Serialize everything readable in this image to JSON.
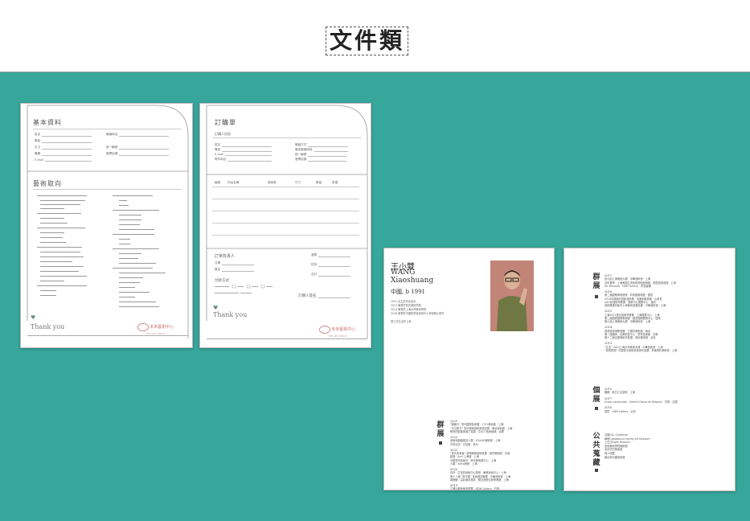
{
  "header": {
    "title": "文件類"
  },
  "doc1": {
    "section1_title": "基本資料",
    "fields_left": [
      "姓名",
      "電話",
      "生日",
      "職業",
      "E-mail"
    ],
    "fields_right": [
      "聯絡地址",
      "統一編號",
      "發票抬頭"
    ],
    "section2_title": "藝術取向",
    "thank_you": "Thank you",
    "logo_name": "未未藝術中心",
    "logo_en": "THE ART SPACE"
  },
  "doc2": {
    "section1_title": "訂購單",
    "subtitle": "訂購人訊息",
    "fields_left": [
      "姓名",
      "電話",
      "E-mail",
      "寄件地址"
    ],
    "fields_right": [
      "聯絡方式",
      "最佳聯絡時段",
      "統一編號",
      "發票抬頭"
    ],
    "table_headers": [
      "編號",
      "作品名稱",
      "藝術家",
      "尺寸",
      "數量",
      "售價"
    ],
    "section2_title": "訂單負責人",
    "fields_sign": [
      "日期",
      "簽名"
    ],
    "payment_title": "付款方式",
    "amount_labels": [
      "運費",
      "折扣",
      "合計"
    ],
    "buyer_sign": "訂購人簽名",
    "thank_you": "Thank you",
    "logo_name": "未未藝術中心",
    "logo_en": "THE ART SPACE"
  },
  "doc3": {
    "name_zh": "王小雙",
    "name_en_1": "WANG",
    "name_en_2": "Xiaoshuang",
    "origin": "中國, b 1991",
    "edu": [
      "1991 出生於河北滄州",
      "2012 畢業於西安美術學院",
      "2014 畢業於上海大學美術學院",
      "2018 畢業於中國哲學藝術當代人事術碩士研究"
    ],
    "now": "現工作生活於上海",
    "group_label": "群展",
    "group_shows": [
      {
        "year": "2023",
        "lines": [
          "“脆脆分” 當代國際藝術展 · 1723美術館 · 上海",
          "“今日夜才” 當代美術藝術家邀請展 · 海派藝術館 · 上海",
          "歌聲的鏡像與潮了寫題 · 意AO7藝術機構 · 合肥"
        ]
      },
      {
        "year": "2022",
        "lines": [
          "藝術和遊戲邀請人展 · YOUNG美術館 · 上海",
          "不同北京 · 日控館 · 杭州"
        ]
      },
      {
        "year": "2021",
        "lines": [
          "“當代未來者” 新興美術藝術家展 · 城市美術館 · 天津",
          "新館 · Art+上海館 · 上海",
          "中國當代藝術中 · 當代美術館中心 · 上海",
          "人類 · Artco美術 · 上海"
        ]
      },
      {
        "year": "2020",
        "lines": [
          "向外 · 生長的藝術中心發覺 · 華美藝術中心 · 上海",
          "第十八屆 “新中國” 藝術邀請聯展 · 中華藝術宮 · 上海",
          "鄰裡聯 · 高此屬寺藝誌 · 塑出藝數位術學美館 · 上海"
        ]
      },
      {
        "year": "2019",
        "lines": [
          "江蘇后網藝術學響展 · HDM Gallery · 巴黎",
          "In There Life On Earth · 閃爍大道美術館 · 上本其",
          "法國吊數在行響年展 · 安閣大學 · 法國",
          "Art Brussels · HDM Gallery · 布魯塞爾"
        ]
      },
      {
        "year": "2018",
        "lines": [
          "江蘇后網藝術學響展 · HDM Gallery · 巴黎",
          "藝術面對 · 當時學術中心 · 杭州",
          "青春在於旬形 · 雲何何 · 本藝術當代美術館 · 上海",
          "國藝術中國學術學術計劃 · 國藝術學術學術 · 澳條哲學"
        ]
      }
    ]
  },
  "doc4": {
    "group_label": "群展",
    "group_shows": [
      {
        "year": "2017",
        "lines": [
          "壽九創上海美術大展 · 中華藝術宮 · 上海",
          "百年寶學 · 上海美國主事藝術當館藝術館 · 觀點藝術藝館 · 上海",
          "Art Brussels · HDM Gallery · 布魯塞爾"
        ]
      },
      {
        "year": "2016",
        "lines": [
          "第二屆國際美術館家 · 向家國美術館 · 國當",
          "2016中國版印當新藝術展 · 長美術新繪畫 · 山東省",
          "AAO創藝術學響展 · 藝術中心展覽中心 · 福州",
          "藝術雙種印象作上海美術收藏品展 · 中華藝術宮 · 上海"
        ]
      },
      {
        "year": "2015",
        "lines": [
          "上海2012當代藝術學響展 · 上海展覽中心 · 上海",
          "第二屆國際國際美術館 · 國當國際展覽中心 · 國當",
          "第六屆上海美術大展 · 中華藝術宮 · 上海"
        ]
      },
      {
        "year": "2014",
        "lines": [
          "香港藝術博覽藝展 · 江蘇省美術館 · 南京",
          "第一屆總術 · 北美術藝中心 · 當事藝術館 · 宇都",
          "第十二屆全國美術作品展 · 湖北美術館 · 武漢"
        ]
      },
      {
        "year": "2013",
        "lines": [
          "“生活” 2013上海青年美術大展 · 中華藝術宮 · 上海",
          "“藝院表現” 中國當今藝術家藝術作品展 · 多倫現代美術館 · 上海"
        ]
      }
    ],
    "solo_label": "個展",
    "solo_shows": [
      {
        "year": "2019",
        "lines": [
          "纖細 · 紫日之吉藝術 · 上海"
        ]
      },
      {
        "year": "2017",
        "lines": [
          "Urban Landscape · Galerie Diane de Polignac · 巴黎 · 法國"
        ]
      },
      {
        "year": "2016",
        "lines": [
          "城境 · HDM Gallery · 北京"
        ]
      }
    ],
    "collection_label": "公共蒐藏",
    "collections": [
      "法國DSL Collection",
      "華僑Capobianco Family Art Museum",
      "上石汶Sight Museum",
      "西安美術學院美術館",
      "北京仿巴美術館",
      "個人收藏",
      "南京和中國藝術館"
    ]
  }
}
